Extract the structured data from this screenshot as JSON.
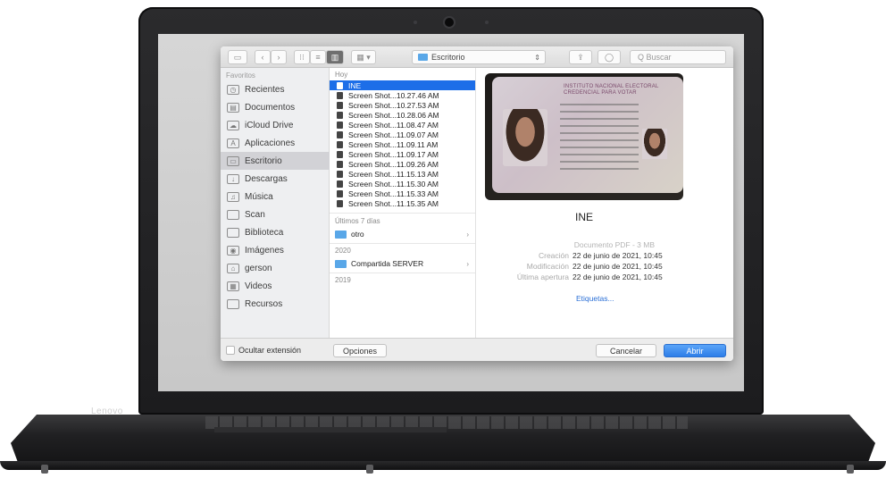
{
  "laptop": {
    "brand_label": "Lenovo"
  },
  "toolbar": {
    "view_icons": [
      "sidebar-toggle",
      "back",
      "forward",
      "icon-view",
      "list-view",
      "column-view",
      "gallery-view"
    ],
    "location": "Escritorio",
    "search_placeholder": "Q Buscar"
  },
  "sidebar": {
    "header": "Favoritos",
    "items": [
      {
        "label": "Recientes",
        "icon": "clock-icon"
      },
      {
        "label": "Documentos",
        "icon": "document-icon"
      },
      {
        "label": "iCloud Drive",
        "icon": "cloud-icon"
      },
      {
        "label": "Aplicaciones",
        "icon": "apps-icon"
      },
      {
        "label": "Escritorio",
        "icon": "desktop-icon",
        "selected": true
      },
      {
        "label": "Descargas",
        "icon": "download-icon"
      },
      {
        "label": "Música",
        "icon": "music-icon"
      },
      {
        "label": "Scan",
        "icon": "folder-icon"
      },
      {
        "label": "Biblioteca",
        "icon": "folder-icon"
      },
      {
        "label": "Imágenes",
        "icon": "camera-icon"
      },
      {
        "label": "gerson",
        "icon": "home-icon"
      },
      {
        "label": "Videos",
        "icon": "film-icon"
      },
      {
        "label": "Recursos",
        "icon": "folder-icon"
      }
    ]
  },
  "files": {
    "group_today": "Hoy",
    "items": [
      {
        "name": "INE",
        "selected": true
      },
      {
        "name": "Screen Shot...10.27.46 AM"
      },
      {
        "name": "Screen Shot...10.27.53 AM"
      },
      {
        "name": "Screen Shot...10.28.06 AM"
      },
      {
        "name": "Screen Shot...11.08.47 AM"
      },
      {
        "name": "Screen Shot...11.09.07 AM"
      },
      {
        "name": "Screen Shot...11.09.11 AM"
      },
      {
        "name": "Screen Shot...11.09.17 AM"
      },
      {
        "name": "Screen Shot...11.09.26 AM"
      },
      {
        "name": "Screen Shot...11.15.13 AM"
      },
      {
        "name": "Screen Shot...11.15.30 AM"
      },
      {
        "name": "Screen Shot...11.15.33 AM"
      },
      {
        "name": "Screen Shot...11.15.35 AM"
      }
    ],
    "group_week": "Últimos 7 días",
    "folder_week": "otro",
    "group_2020": "2020",
    "folder_2020": "Compartida SERVER",
    "group_2019": "2019"
  },
  "preview": {
    "card_title": "INSTITUTO NACIONAL ELECTORAL CREDENCIAL PARA VOTAR",
    "name": "INE",
    "kind": "Documento PDF - 3 MB",
    "meta": [
      {
        "key": "Creación",
        "value": "22 de junio de 2021, 10:45"
      },
      {
        "key": "Modificación",
        "value": "22 de junio de 2021, 10:45"
      },
      {
        "key": "Última apertura",
        "value": "22 de junio de 2021, 10:45"
      }
    ],
    "tags": "Etiquetas..."
  },
  "footer": {
    "hide_extension": "Ocultar extensión",
    "options": "Opciones",
    "cancel": "Cancelar",
    "open": "Abrir"
  },
  "colors": {
    "accent": "#1d6ee8",
    "folder": "#59a7e8",
    "lid": "#1c1c1e"
  }
}
